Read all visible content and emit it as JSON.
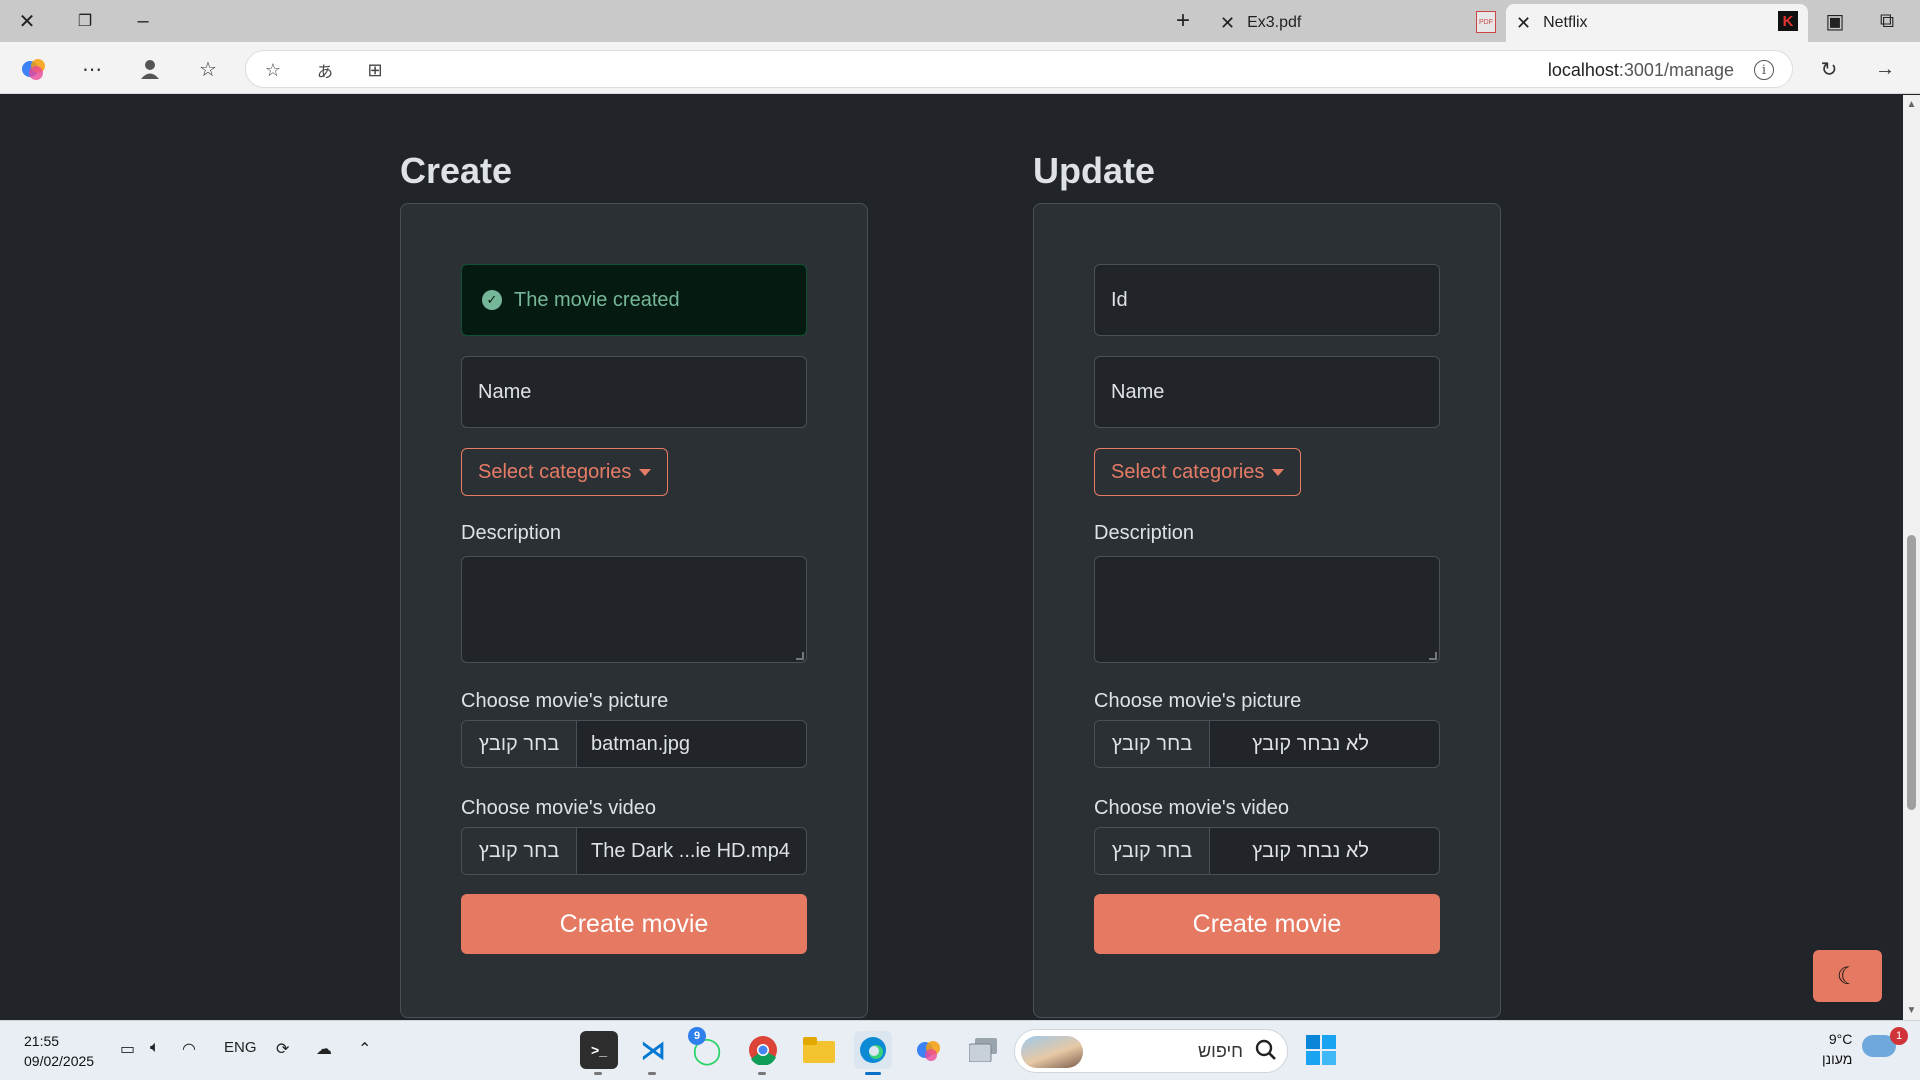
{
  "browser": {
    "tabs": [
      {
        "title": "Ex3.pdf",
        "active": false
      },
      {
        "title": "Netflix",
        "active": true
      }
    ],
    "address": {
      "host": "localhost",
      "path": ":3001/manage"
    }
  },
  "create": {
    "title": "Create",
    "alert": "The movie created",
    "name_placeholder": "Name",
    "categories_label": "Select categories",
    "description_label": "Description",
    "picture_label": "Choose movie's picture",
    "picture_button": "בחר קובץ",
    "picture_file": "batman.jpg",
    "video_label": "Choose movie's video",
    "video_button": "בחר קובץ",
    "video_file": "The Dark ...ie HD.mp4",
    "submit_label": "Create movie"
  },
  "update": {
    "title": "Update",
    "id_placeholder": "Id",
    "name_placeholder": "Name",
    "categories_label": "Select categories",
    "description_label": "Description",
    "picture_label": "Choose movie's picture",
    "picture_button": "בחר קובץ",
    "picture_file": "לא נבחר קובץ",
    "video_label": "Choose movie's video",
    "video_button": "בחר קובץ",
    "video_file": "לא נבחר קובץ",
    "submit_label": "Create movie"
  },
  "theme_toggle_icon": "moon-icon",
  "colors": {
    "accent": "#e57962",
    "success": "#75b798",
    "background": "#212529",
    "card": "#2b3035"
  },
  "taskbar": {
    "time": "21:55",
    "date": "09/02/2025",
    "language": "ENG",
    "search_placeholder": "חיפוש",
    "whatsapp_badge": "9",
    "weather_temp": "9°C",
    "weather_desc": "מעונן",
    "notification_count": "1"
  }
}
